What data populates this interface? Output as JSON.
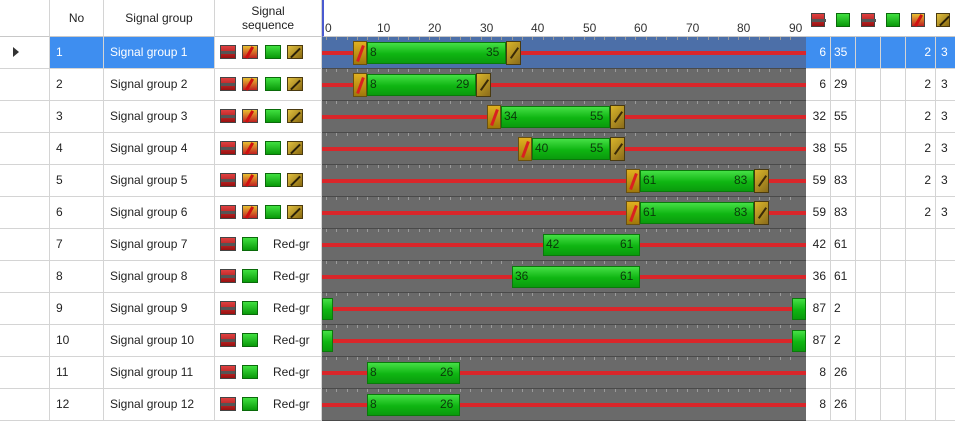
{
  "columns": {
    "no": "No",
    "signal_group": "Signal group",
    "signal_sequence_line1": "Signal",
    "signal_sequence_line2": "sequence"
  },
  "timeline": {
    "cycle": 90,
    "tick_labels": [
      "0",
      "10",
      "20",
      "30",
      "40",
      "50",
      "60",
      "70",
      "80",
      "90"
    ]
  },
  "extra_column_icons": [
    "red-icon",
    "green-icon",
    "red-icon",
    "green-icon",
    "red-amber-icon",
    "amber-icon"
  ],
  "colors": {
    "selection": "#3e8ef0",
    "timeline_bg": "#6a6a6a",
    "red": "#d9262a",
    "green": "#14b814",
    "amber": "#c9a020"
  },
  "rows": [
    {
      "no": "1",
      "name": "Signal group 1",
      "sequence": "",
      "green_start": "8",
      "green_end": "35",
      "red_end": "6",
      "green_end_col": "35",
      "amber": "2",
      "extra": "3",
      "selected": true,
      "type": "full"
    },
    {
      "no": "2",
      "name": "Signal group 2",
      "sequence": "",
      "green_start": "8",
      "green_end": "29",
      "red_end": "6",
      "green_end_col": "29",
      "amber": "2",
      "extra": "3",
      "selected": false,
      "type": "full"
    },
    {
      "no": "3",
      "name": "Signal group 3",
      "sequence": "",
      "green_start": "34",
      "green_end": "55",
      "red_end": "32",
      "green_end_col": "55",
      "amber": "2",
      "extra": "3",
      "selected": false,
      "type": "full"
    },
    {
      "no": "4",
      "name": "Signal group 4",
      "sequence": "",
      "green_start": "40",
      "green_end": "55",
      "red_end": "38",
      "green_end_col": "55",
      "amber": "2",
      "extra": "3",
      "selected": false,
      "type": "full"
    },
    {
      "no": "5",
      "name": "Signal group 5",
      "sequence": "",
      "green_start": "61",
      "green_end": "83",
      "red_end": "59",
      "green_end_col": "83",
      "amber": "2",
      "extra": "3",
      "selected": false,
      "type": "full"
    },
    {
      "no": "6",
      "name": "Signal group 6",
      "sequence": "",
      "green_start": "61",
      "green_end": "83",
      "red_end": "59",
      "green_end_col": "83",
      "amber": "2",
      "extra": "3",
      "selected": false,
      "type": "full"
    },
    {
      "no": "7",
      "name": "Signal group 7",
      "sequence": "Red-gr",
      "green_start": "42",
      "green_end": "61",
      "red_end": "42",
      "green_end_col": "61",
      "amber": "",
      "extra": "",
      "selected": false,
      "type": "rg"
    },
    {
      "no": "8",
      "name": "Signal group 8",
      "sequence": "Red-gr",
      "green_start": "36",
      "green_end": "61",
      "red_end": "36",
      "green_end_col": "61",
      "amber": "",
      "extra": "",
      "selected": false,
      "type": "rg"
    },
    {
      "no": "9",
      "name": "Signal group 9",
      "sequence": "Red-gr",
      "green_start": "",
      "green_end": "",
      "red_end": "87",
      "green_end_col": "2",
      "amber": "",
      "extra": "",
      "selected": false,
      "type": "rg_wrap"
    },
    {
      "no": "10",
      "name": "Signal group 10",
      "sequence": "Red-gr",
      "green_start": "",
      "green_end": "",
      "red_end": "87",
      "green_end_col": "2",
      "amber": "",
      "extra": "",
      "selected": false,
      "type": "rg_wrap"
    },
    {
      "no": "11",
      "name": "Signal group 11",
      "sequence": "Red-gr",
      "green_start": "8",
      "green_end": "26",
      "red_end": "8",
      "green_end_col": "26",
      "amber": "",
      "extra": "",
      "selected": false,
      "type": "rg"
    },
    {
      "no": "12",
      "name": "Signal group 12",
      "sequence": "Red-gr",
      "green_start": "8",
      "green_end": "26",
      "red_end": "8",
      "green_end_col": "26",
      "amber": "",
      "extra": "",
      "selected": false,
      "type": "rg"
    }
  ]
}
